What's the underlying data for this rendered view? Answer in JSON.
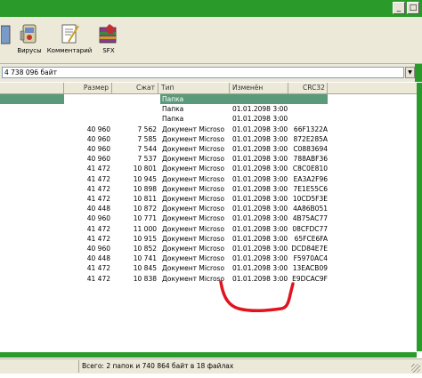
{
  "toolbar": {
    "buttons": [
      {
        "label": "",
        "icon": "partial-icon"
      },
      {
        "label": "Вирусы",
        "icon": "virus-scan-icon"
      },
      {
        "label": "Комментарий",
        "icon": "comment-icon"
      },
      {
        "label": "SFX",
        "icon": "sfx-icon"
      }
    ]
  },
  "address": {
    "value": "4 738 096 байт",
    "dropdown_icon": "chevron-down-icon"
  },
  "columns": {
    "size": "Размер",
    "packed": "Сжат",
    "type": "Тип",
    "modified": "Изменён",
    "crc": "CRC32"
  },
  "rows": [
    {
      "size": "",
      "packed": "",
      "type": "Папка",
      "modified": "",
      "crc": ""
    },
    {
      "size": "",
      "packed": "",
      "type": "Папка",
      "modified": "01.01.2098 3:00",
      "crc": ""
    },
    {
      "size": "",
      "packed": "",
      "type": "Папка",
      "modified": "01.01.2098 3:00",
      "crc": ""
    },
    {
      "size": "40 960",
      "packed": "7 562",
      "type": "Документ Microsoft...",
      "modified": "01.01.2098 3:00",
      "crc": "66F1322A"
    },
    {
      "size": "40 960",
      "packed": "7 585",
      "type": "Документ Microsoft...",
      "modified": "01.01.2098 3:00",
      "crc": "872E285A"
    },
    {
      "size": "40 960",
      "packed": "7 544",
      "type": "Документ Microsoft...",
      "modified": "01.01.2098 3:00",
      "crc": "C0883694"
    },
    {
      "size": "40 960",
      "packed": "7 537",
      "type": "Документ Microsoft...",
      "modified": "01.01.2098 3:00",
      "crc": "788ABF36"
    },
    {
      "size": "41 472",
      "packed": "10 801",
      "type": "Документ Microsoft...",
      "modified": "01.01.2098 3:00",
      "crc": "C8C0E810"
    },
    {
      "size": "41 472",
      "packed": "10 945",
      "type": "Документ Microsoft...",
      "modified": "01.01.2098 3:00",
      "crc": "EA3A2F96"
    },
    {
      "size": "41 472",
      "packed": "10 898",
      "type": "Документ Microsoft...",
      "modified": "01.01.2098 3:00",
      "crc": "7E1E55C6"
    },
    {
      "size": "41 472",
      "packed": "10 811",
      "type": "Документ Microsoft...",
      "modified": "01.01.2098 3:00",
      "crc": "10CD5F3E"
    },
    {
      "size": "40 448",
      "packed": "10 872",
      "type": "Документ Microsoft...",
      "modified": "01.01.2098 3:00",
      "crc": "4A86B051"
    },
    {
      "size": "40 960",
      "packed": "10 771",
      "type": "Документ Microsoft...",
      "modified": "01.01.2098 3:00",
      "crc": "4B75AC77"
    },
    {
      "size": "41 472",
      "packed": "11 000",
      "type": "Документ Microsoft...",
      "modified": "01.01.2098 3:00",
      "crc": "08CFDC77"
    },
    {
      "size": "41 472",
      "packed": "10 915",
      "type": "Документ Microsoft...",
      "modified": "01.01.2098 3:00",
      "crc": "65FCE6FA"
    },
    {
      "size": "40 960",
      "packed": "10 852",
      "type": "Документ Microsoft...",
      "modified": "01.01.2098 3:00",
      "crc": "DCD84E7E"
    },
    {
      "size": "40 448",
      "packed": "10 741",
      "type": "Документ Microsoft...",
      "modified": "01.01.2098 3:00",
      "crc": "F5970AC4"
    },
    {
      "size": "41 472",
      "packed": "10 845",
      "type": "Документ Microsoft...",
      "modified": "01.01.2098 3:00",
      "crc": "13EACB09"
    },
    {
      "size": "41 472",
      "packed": "10 838",
      "type": "Документ Microsoft...",
      "modified": "01.01.2098 3:00",
      "crc": "E9DCAC9F"
    }
  ],
  "status": {
    "text": "Всего: 2 папок и 740 864 байт в 18 файлах"
  },
  "colors": {
    "selection": "#5a9a7a",
    "annotation": "#e0141e",
    "frame_green": "#2a9a2a"
  }
}
